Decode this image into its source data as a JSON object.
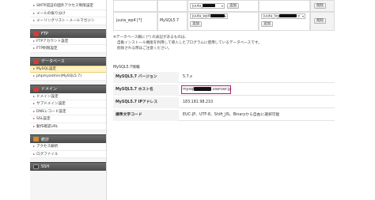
{
  "sidebar": {
    "top_links": [
      "SMTP認証の国外アクセス制限設定",
      "メールの振り分け",
      "メーリングリスト・メールマガジン"
    ],
    "sections": [
      {
        "title": "FTP",
        "icon_color": "#c9403a",
        "icon": "ftp-folder-icon",
        "links": [
          "FTPアカウント設定",
          "FTP制限設定"
        ]
      },
      {
        "title": "データベース",
        "icon_color": "#c9403a",
        "icon": "database-icon",
        "links": [
          "MySQL設定",
          "phpmyadmin(MySQL5.7)"
        ],
        "active_index": 0
      },
      {
        "title": "ドメイン",
        "icon_color": "#c9403a",
        "icon": "domain-globe-icon",
        "links": [
          "ドメイン設定",
          "サブドメイン設定",
          "DNSレコード設定",
          "SSL設定",
          "動作確認URL"
        ]
      },
      {
        "title": "統計",
        "icon_color": "#d48a2a",
        "icon": "statistics-icon",
        "links": [
          "アクセス解析",
          "ログファイル"
        ]
      },
      {
        "title": "SSH",
        "icon_color": "#3a3a3a",
        "icon": "ssh-terminal-icon",
        "links": []
      }
    ]
  },
  "db_table": {
    "row1": {
      "user_select": "juuta_",
      "user_suffix": "",
      "add_button": "追加",
      "user_select2": "juuta_",
      "user_select2_suffix": "x",
      "add_button2": "追加",
      "delete_button": "削除"
    },
    "row2": {
      "db_name": "juuta_wp4 [*]",
      "version": "MySQL5.7",
      "user_select": "juuta_wp4",
      "add_button": "追加",
      "user_select2": "juuta_log",
      "user_select2_suffix": "x",
      "add_button2": "追加",
      "delete_button": "削除"
    }
  },
  "notes": [
    "※データベース欄に [*] の表記があるものは、",
    "自動インストール機能を利用して導入したプログラムに使用しているデータベースです。",
    "削除される際はご注意ください。"
  ],
  "info_section": {
    "title": "MySQL5.7情報",
    "rows": [
      {
        "label": "MySQL5.7 バージョン",
        "value": "5.7.x"
      },
      {
        "label": "MySQL5.7 ホスト名",
        "value_prefix": "mysql",
        "value_suffix": ".xserver.jp"
      },
      {
        "label": "MySQL5.7 IPアドレス",
        "value": "183.181.98.210"
      },
      {
        "label": "標準文字コード",
        "value": "EUC-JP、UTF-8、Shift_JIS、Binaryから自由に選択可能"
      }
    ]
  },
  "colors": {
    "highlight": "#b51c7a",
    "active_item": "#fff3c4",
    "section_header": "#555555"
  }
}
